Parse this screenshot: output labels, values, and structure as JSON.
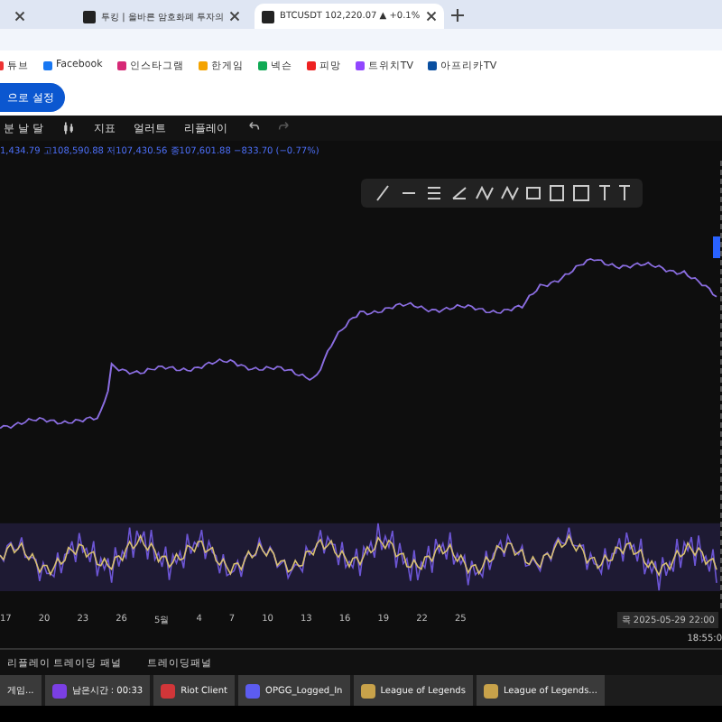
{
  "browser_tabs": [
    {
      "selected": false
    },
    {
      "title": "투킹 | 올바른 암호화폐 투자의",
      "selected": false
    },
    {
      "title": "BTCUSDT 102,220.07 ▲ +0.1%",
      "selected": true
    }
  ],
  "bookmarks": [
    "튜브",
    "Facebook",
    "인스타그램",
    "한게임",
    "넥슨",
    "피망",
    "트위치TV",
    "아프리카TV"
  ],
  "page_button": "으로 설정",
  "chart_toolbar": {
    "interval": "분 날 달",
    "items": [
      "지표",
      "얼러트",
      "리플레이"
    ]
  },
  "ohlc": {
    "open": "1,434.79",
    "high_label": "고",
    "high": "108,590.88",
    "low_label": "저",
    "low": "107,430.56",
    "close_label": "종",
    "close": "107,601.88",
    "change": "−833.70 (−0.77%)"
  },
  "x_axis": [
    "17",
    "20",
    "23",
    "26",
    "5월",
    "4",
    "7",
    "10",
    "13",
    "16",
    "19",
    "22",
    "25"
  ],
  "crosshair_date": "목 2025-05-29   22:00",
  "clock": "18:55:0",
  "bottom_tabs": [
    "리플레이 트레이딩 패널",
    "트레이딩패널"
  ],
  "taskbar": [
    {
      "label": "게임...",
      "kind": "plain"
    },
    {
      "label": "남은시간 : 00:33",
      "kind": "purple"
    },
    {
      "label": "Riot Client",
      "kind": "riot"
    },
    {
      "label": "OPGG_Logged_In",
      "kind": "opgg"
    },
    {
      "label": "League of Legends",
      "kind": "lol"
    },
    {
      "label": "League of Legends...",
      "kind": "lol"
    }
  ]
}
